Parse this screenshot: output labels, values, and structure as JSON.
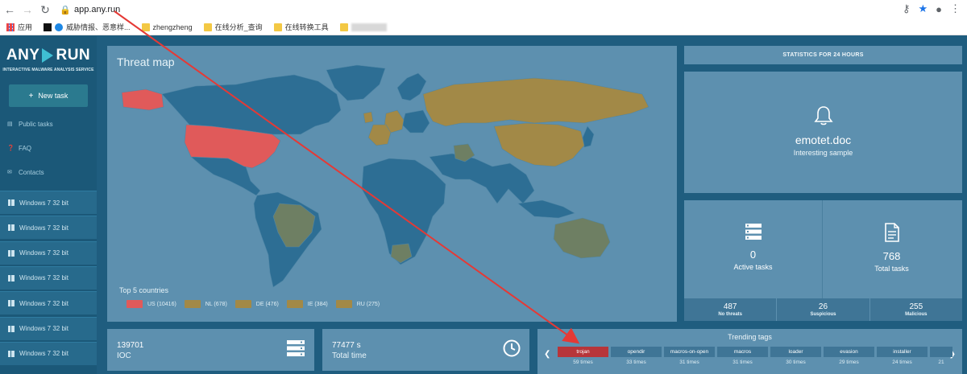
{
  "browser": {
    "url": "app.any.run",
    "bookmarks": [
      "应用",
      "威胁情报、恶意样...",
      "zhengzheng",
      "在线分析_查询",
      "在线转换工具"
    ]
  },
  "sidebar": {
    "logo_left": "ANY",
    "logo_right": "RUN",
    "tagline": "INTERACTIVE MALWARE ANALYSIS SERVICE",
    "new_task": "New task",
    "links": [
      "Public tasks",
      "FAQ",
      "Contacts"
    ],
    "tasks": [
      "Windows 7 32 bit",
      "Windows 7 32 bit",
      "Windows 7 32 bit",
      "Windows 7 32 bit",
      "Windows 7 32 bit",
      "Windows 7 32 bit",
      "Windows 7 32 bit"
    ]
  },
  "map": {
    "title": "Threat map",
    "legend_title": "Top 5 countries",
    "countries": [
      {
        "label": "US (10416)",
        "color": "#e05a5a"
      },
      {
        "label": "NL (678)",
        "color": "#a28947"
      },
      {
        "label": "DE (476)",
        "color": "#a28947"
      },
      {
        "label": "IE (384)",
        "color": "#a28947"
      },
      {
        "label": "RU (275)",
        "color": "#a28947"
      }
    ],
    "colors": {
      "land": "#2d6e94",
      "ocean": "#5d90af",
      "top": "#e05a5a",
      "other": "#a28947",
      "green": "#6e7f63"
    }
  },
  "stats": {
    "header": "STATISTICS FOR 24 HOURS",
    "sample_name": "emotet.doc",
    "sample_sub": "Interesting sample",
    "active_tasks": "0",
    "active_label": "Active tasks",
    "total_tasks": "768",
    "total_label": "Total tasks",
    "no_threats": "487",
    "no_threats_label": "No threats",
    "suspicious": "26",
    "suspicious_label": "Suspicious",
    "malicious": "255",
    "malicious_label": "Malicious"
  },
  "bottom": {
    "ioc_value": "139701",
    "ioc_label": "IOC",
    "time_value": "77477 s",
    "time_label": "Total time"
  },
  "trending": {
    "title": "Trending tags",
    "tags": [
      {
        "name": "trojan",
        "times": "59 times"
      },
      {
        "name": "opendir",
        "times": "33 times"
      },
      {
        "name": "macros-on-open",
        "times": "31 times"
      },
      {
        "name": "macros",
        "times": "31 times"
      },
      {
        "name": "loader",
        "times": "30 times"
      },
      {
        "name": "evasion",
        "times": "29 times"
      },
      {
        "name": "installer",
        "times": "24 times"
      },
      {
        "name": "",
        "times": "21"
      }
    ]
  }
}
